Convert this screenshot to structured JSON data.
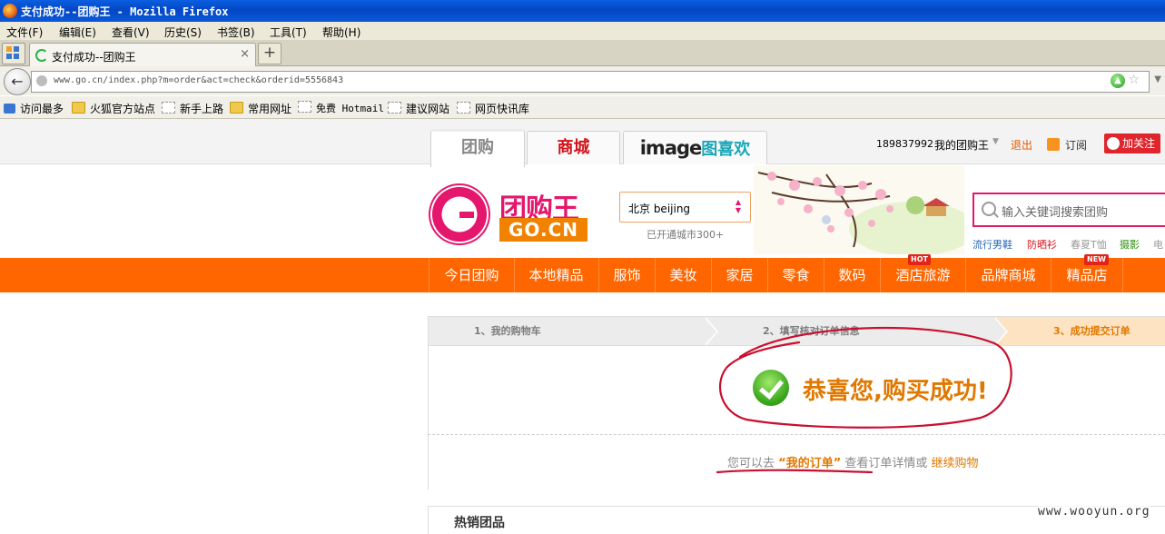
{
  "window": {
    "title": "支付成功--团购王 - Mozilla Firefox"
  },
  "menubar": {
    "items": [
      "文件(F)",
      "编辑(E)",
      "查看(V)",
      "历史(S)",
      "书签(B)",
      "工具(T)",
      "帮助(H)"
    ]
  },
  "tabs": {
    "active_title": "支付成功--团购王",
    "close_glyph": "×",
    "new_tab_glyph": "+"
  },
  "nav": {
    "url": "www.go.cn/index.php?m=order&act=check&orderid=5556843"
  },
  "bookmarks": [
    "访问最多",
    "火狐官方站点",
    "新手上路",
    "常用网址",
    "免费 Hotmail",
    "建议网站",
    "网页快讯库"
  ],
  "site": {
    "channels": [
      "团购",
      "商城"
    ],
    "image_tab": {
      "word": "image",
      "cn": "图喜欢"
    },
    "user_id": "189837992",
    "my_account": "我的团购王",
    "logout": "退出",
    "subscribe": "订阅",
    "follow": "加关注",
    "logo_cn": "团购王",
    "logo_en": "GO.CN",
    "city": "北京 beijing",
    "city_count": "已开通城市300+",
    "search_placeholder": "输入关键词搜索团购",
    "hot_words": [
      "流行男鞋",
      "防晒衫",
      "春夏T恤",
      "摄影",
      "电"
    ],
    "nav_items": [
      "今日团购",
      "本地精品",
      "服饰",
      "美妆",
      "家居",
      "零食",
      "数码",
      "酒店旅游",
      "品牌商城",
      "精品店"
    ],
    "badges": {
      "hotel": "HOT",
      "shop": "NEW"
    }
  },
  "checkout": {
    "steps": [
      "1、我的购物车",
      "2、填写核对订单信息",
      "3、成功提交订单"
    ],
    "success": "恭喜您,购买成功!",
    "hint_prefix": "您可以去",
    "my_order": "“我的订单”",
    "hint_mid": "查看订单详情或",
    "continue": "继续购物",
    "hot_title": "热销团品"
  },
  "watermark": "www.wooyun.org",
  "colors": {
    "brand_orange": "#ff6600",
    "brand_pink": "#e5176d",
    "accent_text": "#e07800",
    "annotation_red": "#c8102e"
  }
}
